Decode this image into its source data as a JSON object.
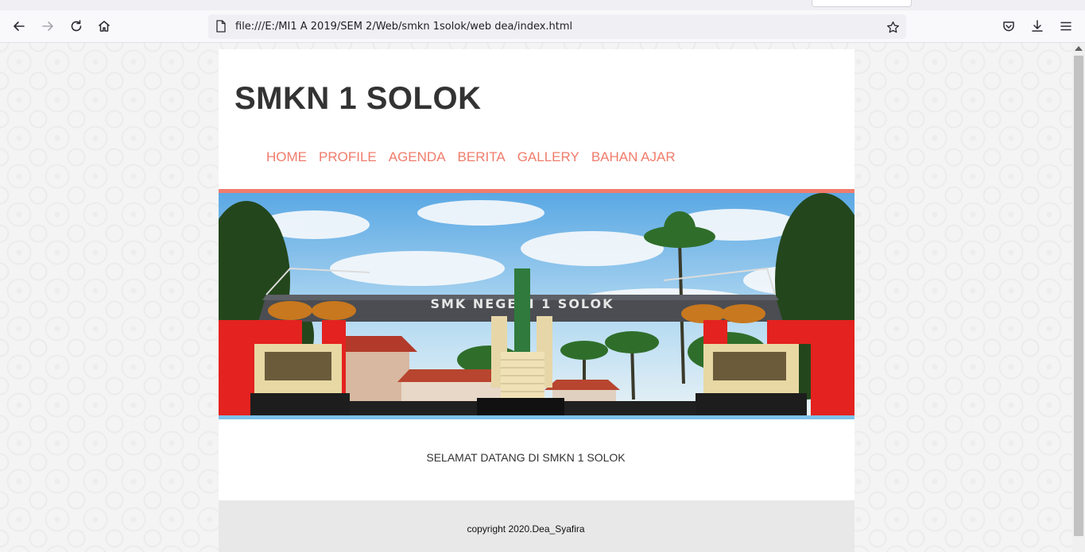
{
  "browser": {
    "url": "file:///E:/MI1 A 2019/SEM 2/Web/smkn 1solok/web dea/index.html",
    "icons": [
      "back-icon",
      "forward-icon",
      "reload-icon",
      "home-icon",
      "page-icon",
      "bookmark-star-icon",
      "pocket-icon",
      "download-icon",
      "menu-icon"
    ]
  },
  "site": {
    "title": "SMKN 1 SOLOK",
    "nav": [
      "HOME",
      "PROFILE",
      "AGENDA",
      "BERITA",
      "GALLERY",
      "BAHAN AJAR"
    ],
    "banner_sign": "SMK NEGERI 1 SOLOK",
    "welcome": "SELAMAT DATANG DI SMKN 1 SOLOK",
    "footer": "copyright 2020.Dea_Syafira"
  },
  "colors": {
    "accent": "#f07c6c",
    "banner_bottom": "#7ec2ea",
    "title": "#333333",
    "footer_bg": "#e8e8e8"
  }
}
